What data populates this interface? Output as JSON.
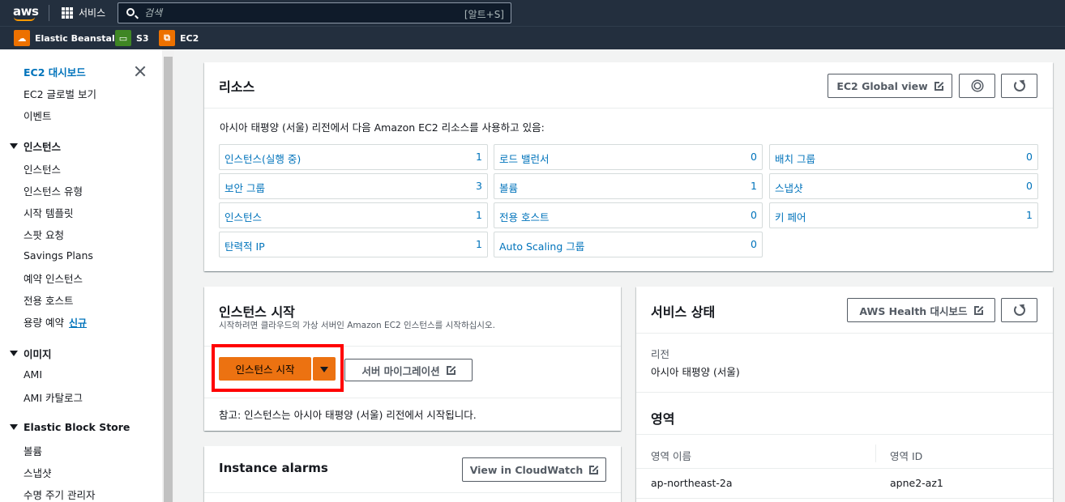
{
  "topnav": {
    "logo": "aws",
    "services_label": "서비스",
    "search_placeholder": "검색",
    "search_shortcut": "[알트+S]"
  },
  "favorites": [
    {
      "label": "Elastic Beanstalk",
      "icon": "elastic-beanstalk-icon",
      "color": "#ed7100"
    },
    {
      "label": "S3",
      "icon": "s3-bucket-icon",
      "color": "#3f8624"
    },
    {
      "label": "EC2",
      "icon": "ec2-icon",
      "color": "#ed7100"
    }
  ],
  "sidebar": {
    "top_items": [
      "EC2 대시보드",
      "EC2 글로벌 보기",
      "이벤트"
    ],
    "sections": [
      {
        "title": "인스턴스",
        "items": [
          "인스턴스",
          "인스턴스 유형",
          "시작 템플릿",
          "스팟 요청",
          "Savings Plans",
          "예약 인스턴스",
          "전용 호스트",
          "용량 예약"
        ]
      },
      {
        "title": "이미지",
        "items": [
          "AMI",
          "AMI 카탈로그"
        ]
      },
      {
        "title": "Elastic Block Store",
        "items": [
          "볼륨",
          "스냅샷",
          "수명 주기 관리자"
        ]
      }
    ],
    "new_badge": "신규"
  },
  "resources": {
    "title": "리소스",
    "global_view_label": "EC2 Global view",
    "description": "아시아 태평양 (서울) 리전에서 다음 Amazon EC2 리소스를 사용하고 있음:",
    "items": [
      {
        "label": "인스턴스(실행 중)",
        "count": "1"
      },
      {
        "label": "로드 밸런서",
        "count": "0"
      },
      {
        "label": "배치 그룹",
        "count": "0"
      },
      {
        "label": "보안 그룹",
        "count": "3"
      },
      {
        "label": "볼륨",
        "count": "1"
      },
      {
        "label": "스냅샷",
        "count": "0"
      },
      {
        "label": "인스턴스",
        "count": "1"
      },
      {
        "label": "전용 호스트",
        "count": "0"
      },
      {
        "label": "키 페어",
        "count": "1"
      },
      {
        "label": "탄력적 IP",
        "count": "1"
      },
      {
        "label": "Auto Scaling 그룹",
        "count": "0"
      }
    ]
  },
  "launch": {
    "title": "인스턴스 시작",
    "subtitle": "시작하려면 클라우드의 가상 서버인 Amazon EC2 인스턴스를 시작하십시오.",
    "launch_button": "인스턴스 시작",
    "migration_button": "서버 마이그레이션",
    "note": "참고: 인스턴스는 아시아 태평양 (서울) 리전에서 시작됩니다."
  },
  "alarms": {
    "title": "Instance alarms",
    "cloudwatch_button": "View in CloudWatch"
  },
  "service_health": {
    "title": "서비스 상태",
    "health_button": "AWS Health 대시보드",
    "region_label": "리전",
    "region_value": "아시아 태평양 (서울)",
    "zones_title": "영역",
    "zone_name_header": "영역 이름",
    "zone_id_header": "영역 ID",
    "zone_name": "ap-northeast-2a",
    "zone_id": "apne2-az1"
  },
  "colors": {
    "nav_bg": "#232f3e",
    "link": "#0073bb",
    "primary_button": "#ec7211",
    "highlight": "#ff0000"
  }
}
